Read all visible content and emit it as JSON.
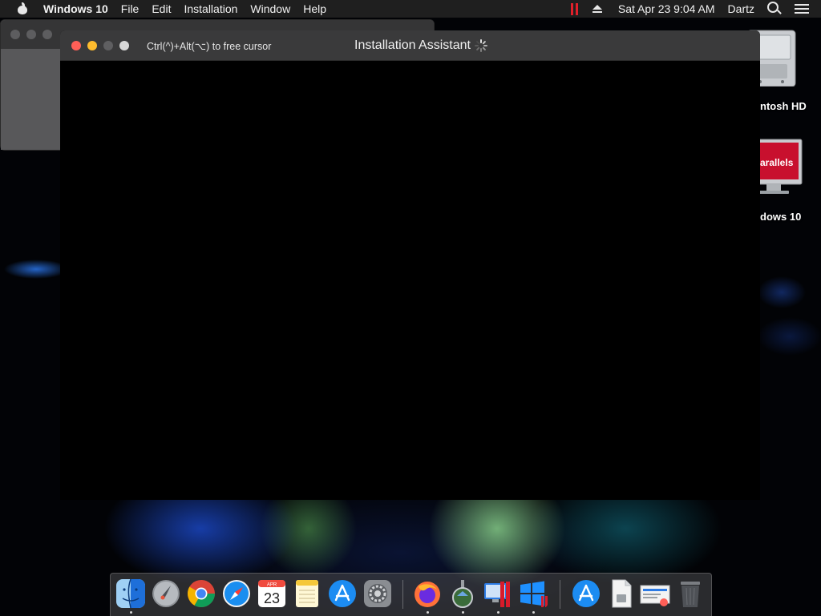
{
  "menubar": {
    "app_name": "Windows 10",
    "menus": [
      "File",
      "Edit",
      "Installation",
      "Window",
      "Help"
    ],
    "clock": "Sat Apr 23  9:04 AM",
    "user": "Dartz"
  },
  "window": {
    "title": "Installation Assistant",
    "cursor_hint": "Ctrl(^)+Alt(⌥) to free cursor"
  },
  "desktop": {
    "icons": [
      {
        "label": "ntosh HD",
        "icon": "hard-drive-icon"
      },
      {
        "label": "dows 10",
        "icon": "parallels-vm-icon",
        "badge": "arallels"
      }
    ]
  },
  "calendar_icon": {
    "month": "APR",
    "day": "23"
  },
  "dock": {
    "apps": [
      "finder-icon",
      "launchpad-icon",
      "chrome-icon",
      "safari-icon",
      "calendar-icon",
      "notes-icon",
      "app-store-icon",
      "system-preferences-icon",
      "firefox-icon",
      "installer-icon",
      "parallels-desktop-icon",
      "windows-10-vm-icon",
      "downloads-folder-icon",
      "document-icon",
      "preview-icon",
      "trash-icon"
    ]
  },
  "colors": {
    "close": "#ff5f57",
    "minimize": "#febc2e",
    "parallels_red": "#e0202a",
    "menubar_bg": "#1f1f1f"
  }
}
